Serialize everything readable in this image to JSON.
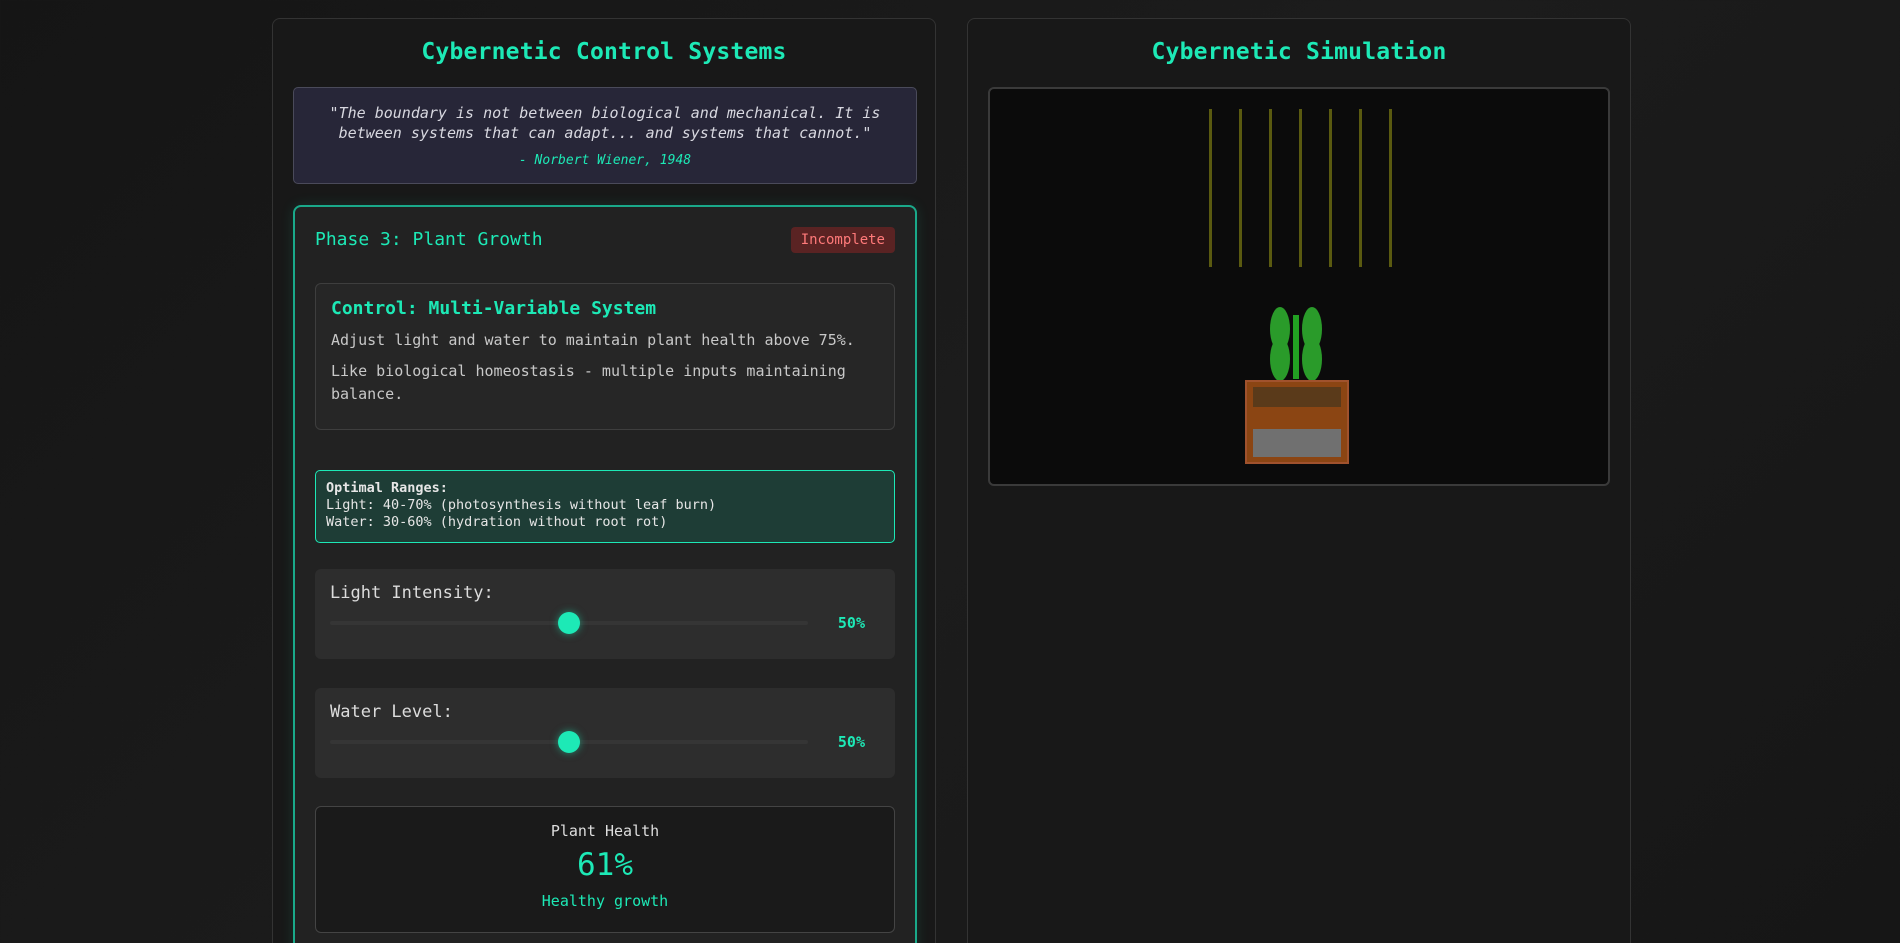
{
  "left": {
    "title": "Cybernetic Control Systems",
    "quote": {
      "text": "\"The boundary is not between biological and mechanical. It is between systems that can adapt... and systems that cannot.\"",
      "author": "- Norbert Wiener, 1948"
    },
    "phase": {
      "title": "Phase 3: Plant Growth",
      "status": "Incomplete",
      "control": {
        "title": "Control: Multi-Variable System",
        "desc1": "Adjust light and water to maintain plant health above 75%.",
        "desc2": "Like biological homeostasis - multiple inputs maintaining balance."
      },
      "ranges": {
        "header": "Optimal Ranges:",
        "light": "Light: 40-70% (photosynthesis without leaf burn)",
        "water": "Water: 30-60% (hydration without root rot)"
      },
      "light_slider": {
        "label": "Light Intensity:",
        "value": 50,
        "display": "50%"
      },
      "water_slider": {
        "label": "Water Level:",
        "value": 50,
        "display": "50%"
      },
      "health": {
        "label": "Plant Health",
        "value": "61%",
        "status": "Healthy growth"
      }
    }
  },
  "right": {
    "title": "Cybernetic Simulation",
    "simulation": {
      "light_beam_count": 7,
      "colors": {
        "beam": "#5a5a10",
        "leaf": "#2a9b2a",
        "stem": "#22a022",
        "pot": "#8b4513",
        "soil": "#5a3a1a",
        "water": "#707070"
      }
    }
  },
  "colors": {
    "accent": "#1de9b6",
    "incomplete": "#ff7a7a"
  }
}
